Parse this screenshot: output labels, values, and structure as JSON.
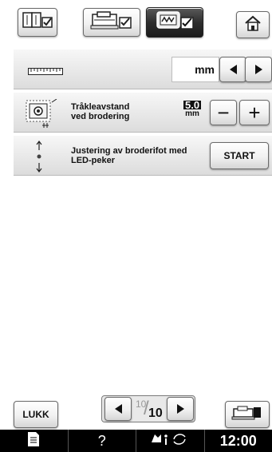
{
  "tabs": [
    {
      "icon": "sewing-settings-icon"
    },
    {
      "icon": "embroidery-settings-icon"
    },
    {
      "icon": "embroidery-frame-settings-icon",
      "active": true
    }
  ],
  "home": {
    "icon": "home-icon"
  },
  "units_row": {
    "icon": "ruler-icon",
    "value": "mm"
  },
  "distance_row": {
    "icon": "frame-distance-icon",
    "label_line1": "Tråkleavstand",
    "label_line2": "ved brodering",
    "value": "5.0",
    "unit": "mm",
    "minus": "−",
    "plus": "+"
  },
  "led_row": {
    "icon": "led-pointer-icon",
    "label_line1": "Justering av broderifot med",
    "label_line2": "LED-peker",
    "button": "START"
  },
  "footer": {
    "close": "LUKK",
    "page_current": "10",
    "page_total": "10",
    "embroidery_icon": "embroidery-machine-icon"
  },
  "status_bar": {
    "doc_icon": "document-icon",
    "help": "?",
    "time": "12:00"
  },
  "colors": {
    "accent": "#000000",
    "panel": "#e6e6e6"
  }
}
